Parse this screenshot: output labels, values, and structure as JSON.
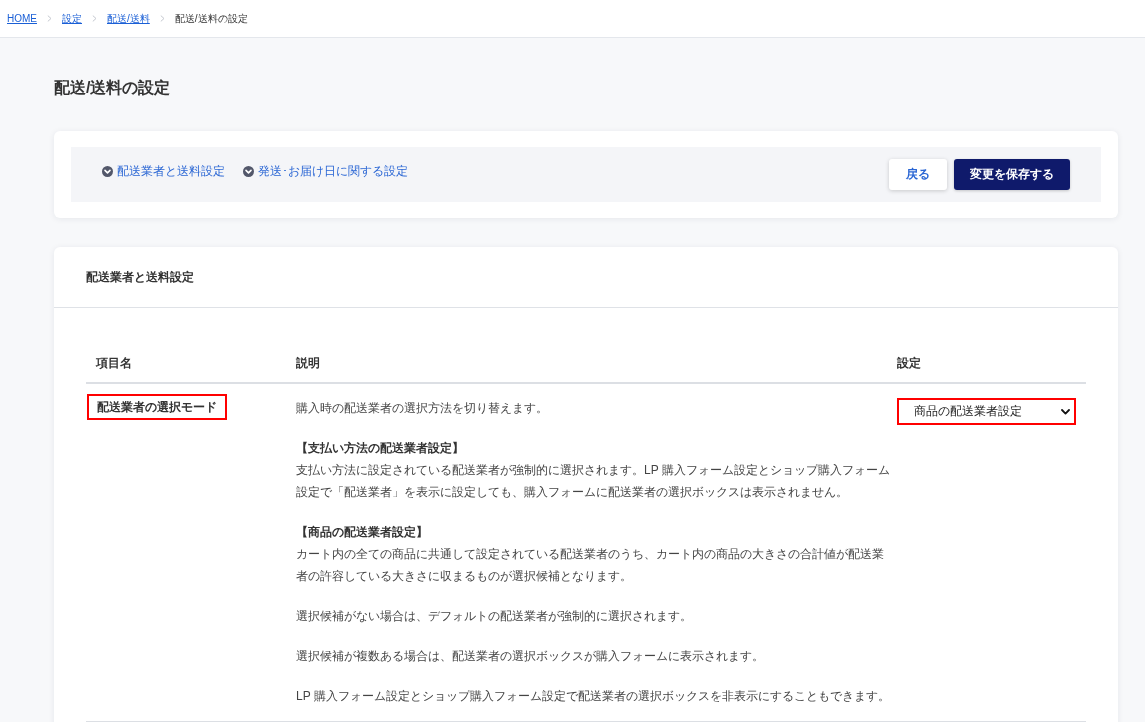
{
  "breadcrumb": [
    {
      "label": "HOME",
      "kind": "link"
    },
    {
      "label": "設定",
      "kind": "link"
    },
    {
      "label": "配送/送料",
      "kind": "link"
    },
    {
      "label": "配送/送料の設定",
      "kind": "current"
    }
  ],
  "page_title": "配送/送料の設定",
  "toolbar": {
    "section_links": [
      {
        "label": "配送業者と送料設定"
      },
      {
        "label": "発送･お届け日に関する設定"
      }
    ],
    "buttons": [
      {
        "label": "戻る",
        "kind": "secondary"
      },
      {
        "label": "変更を保存する",
        "kind": "primary"
      }
    ]
  },
  "section": {
    "title": "配送業者と送料設定",
    "table": {
      "columns": [
        "項目名",
        "説明",
        "設定"
      ],
      "rows": [
        {
          "name": {
            "text": "配送業者の選択モード",
            "highlighted": true
          },
          "description": [
            {
              "text": "購入時の配送業者の選択方法を切り替えます。"
            },
            {
              "heading": "【支払い方法の配送業者設定】",
              "text": "支払い方法に設定されている配送業者が強制的に選択されます。LP 購入フォーム設定とショップ購入フォーム設定で「配送業者」を表示に設定しても、購入フォームに配送業者の選択ボックスは表示されません。"
            },
            {
              "heading": "【商品の配送業者設定】",
              "text": "カート内の全ての商品に共通して設定されている配送業者のうち、カート内の商品の大きさの合計値が配送業者の許容している大きさに収まるものが選択候補となります。"
            },
            {
              "text": "選択候補がない場合は、デフォルトの配送業者が強制的に選択されます。"
            },
            {
              "text": "選択候補が複数ある場合は、配送業者の選択ボックスが購入フォームに表示されます。"
            },
            {
              "text": "LP 購入フォーム設定とショップ購入フォーム設定で配送業者の選択ボックスを非表示にすることもできます。"
            }
          ],
          "setting": {
            "value": "商品の配送業者設定",
            "highlighted": true
          }
        }
      ]
    }
  }
}
